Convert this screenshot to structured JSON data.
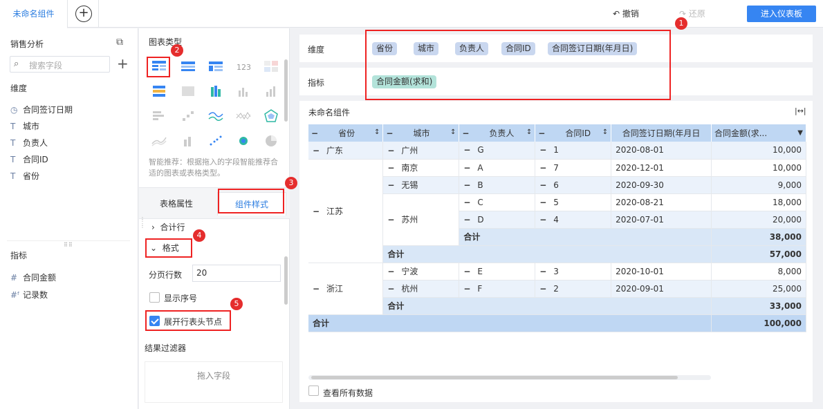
{
  "topbar": {
    "tab_label": "未命名组件",
    "add_tab_symbol": "+",
    "undo_label": "撤销",
    "redo_label": "还原",
    "enter_dashboard_label": "进入仪表板"
  },
  "left_panel": {
    "dataset_title": "销售分析",
    "search_placeholder": "搜索字段",
    "dimension_header": "维度",
    "dimensions": [
      {
        "icon": "clock-icon",
        "label": "合同签订日期"
      },
      {
        "icon": "text-type-icon",
        "label": "城市"
      },
      {
        "icon": "text-type-icon",
        "label": "负责人"
      },
      {
        "icon": "text-type-icon",
        "label": "合同ID"
      },
      {
        "icon": "text-type-icon",
        "label": "省份"
      }
    ],
    "metric_header": "指标",
    "metrics": [
      {
        "icon": "hash-icon",
        "label": "合同金额"
      },
      {
        "icon": "hash-calc-icon",
        "label": "记录数"
      }
    ]
  },
  "middle_panel": {
    "chart_type_title": "图表类型",
    "smart_tip": "智能推荐：根据拖入的字段智能推荐合适的图表或表格类型。",
    "tab_table_attr": "表格属性",
    "tab_component_style": "组件样式",
    "subtotal_row": "合计行",
    "format_section": "格式",
    "page_rows_label": "分页行数",
    "page_rows_value": "20",
    "show_serial_label": "显示序号",
    "show_serial_checked": false,
    "expand_header_label": "展开行表头节点",
    "expand_header_checked": true,
    "result_filter_title": "结果过滤器",
    "drop_field_label": "拖入字段"
  },
  "right_panel": {
    "dimension_label": "维度",
    "dimension_pills": [
      "省份",
      "城市",
      "负责人",
      "合同ID",
      "合同签订日期(年月日)"
    ],
    "metric_label": "指标",
    "metric_pills": [
      "合同金额(求和)"
    ],
    "widget_title": "未命名组件",
    "table": {
      "headers": [
        "省份",
        "城市",
        "负责人",
        "合同ID",
        "合同签订日期(年月日",
        "合同金额(求..."
      ],
      "sort_glyph": "↕",
      "rows": [
        {
          "province": "广东",
          "city": "广州",
          "owner": "G",
          "id": "1",
          "date": "2020-08-01",
          "amount": "10,000"
        },
        {
          "province": "江苏",
          "city": "南京",
          "owner": "A",
          "id": "7",
          "date": "2020-12-01",
          "amount": "10,000"
        },
        {
          "city": "无锡",
          "owner": "B",
          "id": "6",
          "date": "2020-09-30",
          "amount": "9,000"
        },
        {
          "city": "苏州",
          "owner": "C",
          "id": "5",
          "date": "2020-08-21",
          "amount": "18,000"
        },
        {
          "owner": "D",
          "id": "4",
          "date": "2020-07-01",
          "amount": "20,000"
        },
        {
          "subtotal_label": "合计",
          "amount": "38,000"
        },
        {
          "subtotal_label": "合计",
          "amount": "57,000"
        },
        {
          "province": "浙江",
          "city": "宁波",
          "owner": "E",
          "id": "3",
          "date": "2020-10-01",
          "amount": "8,000"
        },
        {
          "city": "杭州",
          "owner": "F",
          "id": "2",
          "date": "2020-09-01",
          "amount": "25,000"
        },
        {
          "subtotal_label": "合计",
          "amount": "33,000"
        },
        {
          "subtotal_label": "合计",
          "amount": "100,000"
        }
      ]
    },
    "view_all_label": "查看所有数据"
  },
  "annotations": [
    "1",
    "2",
    "3",
    "4",
    "5"
  ],
  "colors": {
    "accent": "#3685f2",
    "annotation_red": "#e22222",
    "dim_pill": "#c9d7ef",
    "metric_pill": "#b3e3da",
    "table_header": "#bfd7f3"
  }
}
